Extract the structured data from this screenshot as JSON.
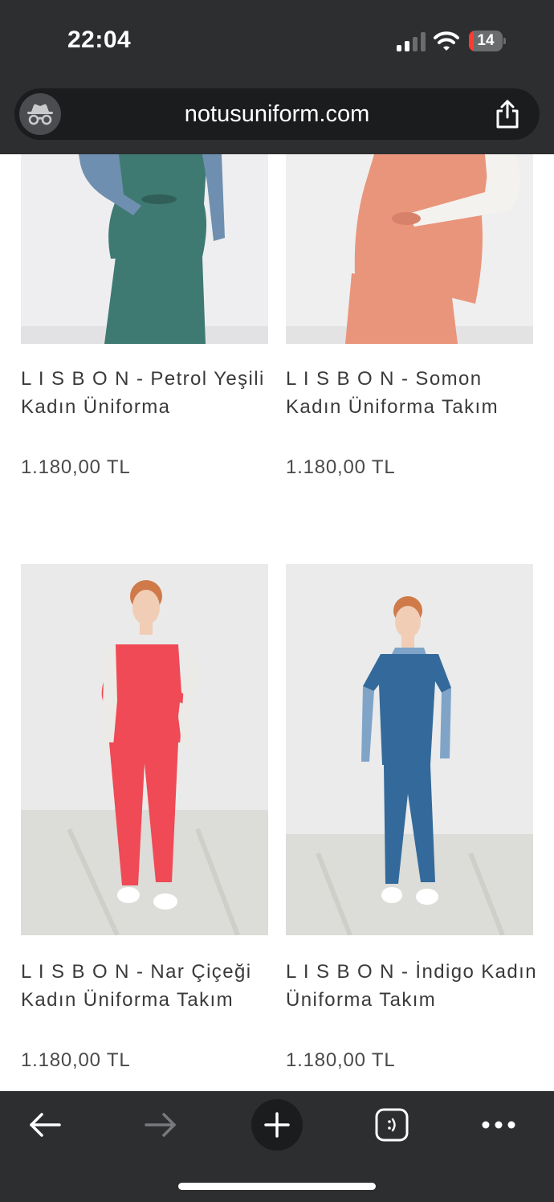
{
  "status_bar": {
    "time": "22:04",
    "battery": "14",
    "battery_level": 0.14
  },
  "browser": {
    "url": "notusuniform.com"
  },
  "products": [
    {
      "title": "L I S B O N - Petrol Yeşili Kadın Üniforma",
      "price": "1.180,00 TL",
      "color": "#3f7a72"
    },
    {
      "title": "L I S B O N - Somon Kadın Üniforma Takım",
      "price": "1.180,00 TL",
      "color": "#e9957c"
    },
    {
      "title": "L I S B O N - Nar Çiçeği Kadın Üniforma Takım",
      "price": "1.180,00 TL",
      "color": "#ef4a55"
    },
    {
      "title": "L I S B O N - İndigo Kadın Üniforma Takım",
      "price": "1.180,00 TL",
      "color": "#336a9b"
    }
  ],
  "icons": {
    "incognito": "incognito-icon",
    "share": "share-icon",
    "back": "back-arrow-icon",
    "forward": "forward-arrow-icon",
    "new_tab": "plus-icon",
    "tabs": "tabs-icon",
    "menu": "more-icon"
  }
}
